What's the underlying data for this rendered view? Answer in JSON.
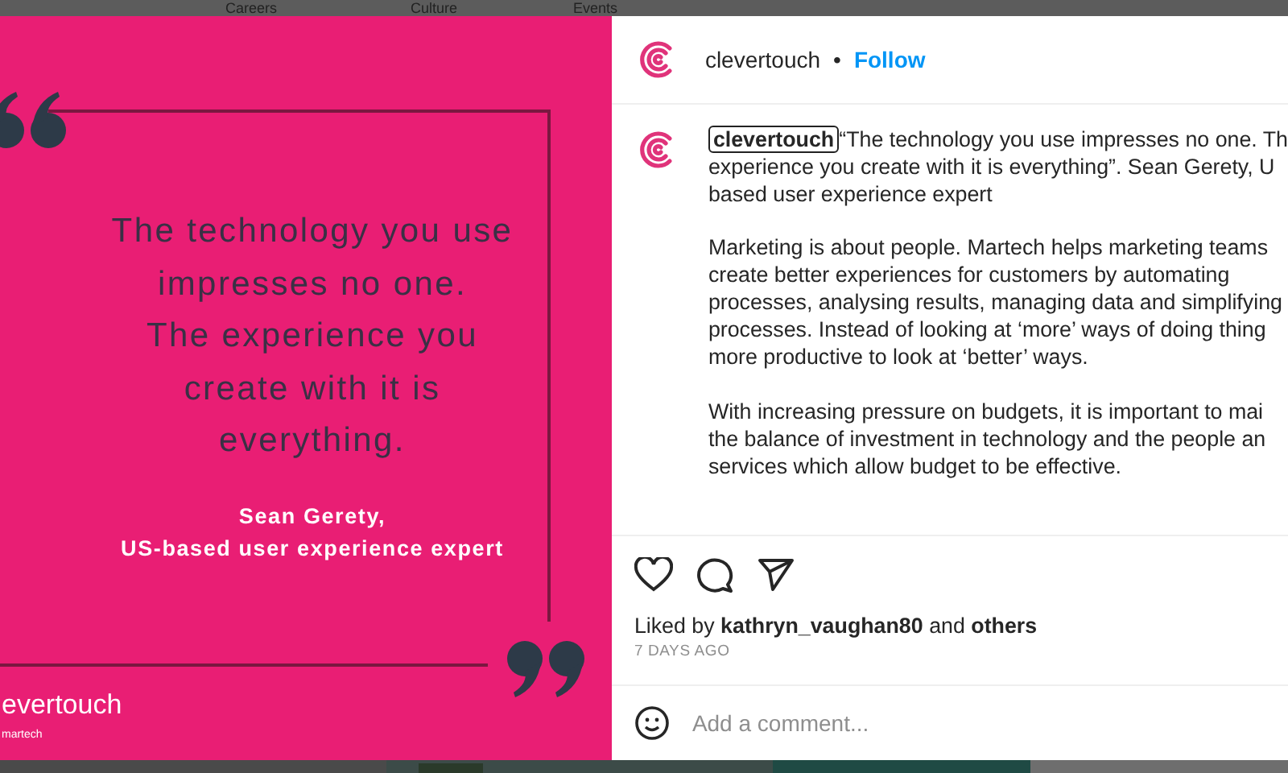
{
  "top_nav": {
    "items": [
      {
        "label": "Careers"
      },
      {
        "label": "Culture"
      },
      {
        "label": "Events"
      }
    ]
  },
  "post_image": {
    "quote_lines": [
      "The technology you use",
      "impresses no one.",
      "The experience you",
      "create with it is",
      "everything."
    ],
    "attribution_lines": [
      "Sean Gerety,",
      "US-based user experience expert"
    ],
    "logo": "evertouch",
    "logo_tagline": "martech"
  },
  "header": {
    "username": "clevertouch",
    "separator": "•",
    "follow": "Follow"
  },
  "caption": {
    "username": "clevertouch",
    "focused": true,
    "paragraphs": [
      [
        "“The technology you use impresses no one. Th",
        "experience you create with it is everything”. Sean Gerety, U",
        "based user experience expert"
      ],
      [
        "Marketing is about people. Martech helps marketing teams",
        "create better experiences for customers by automating",
        "processes, analysing results, managing data and simplifying",
        "processes. Instead of looking at ‘more’ ways of doing thing",
        "more productive to look at ‘better’ ways."
      ],
      [
        "With increasing pressure on budgets, it is important to mai",
        "the balance of investment in technology and the people an",
        "services which allow budget to be effective."
      ]
    ]
  },
  "likes": {
    "prefix": "Liked by",
    "user": "kathryn_vaughan80",
    "middle": "and",
    "suffix": "others"
  },
  "time": "7 DAYS AGO",
  "comment": {
    "placeholder": "Add a comment..."
  }
}
